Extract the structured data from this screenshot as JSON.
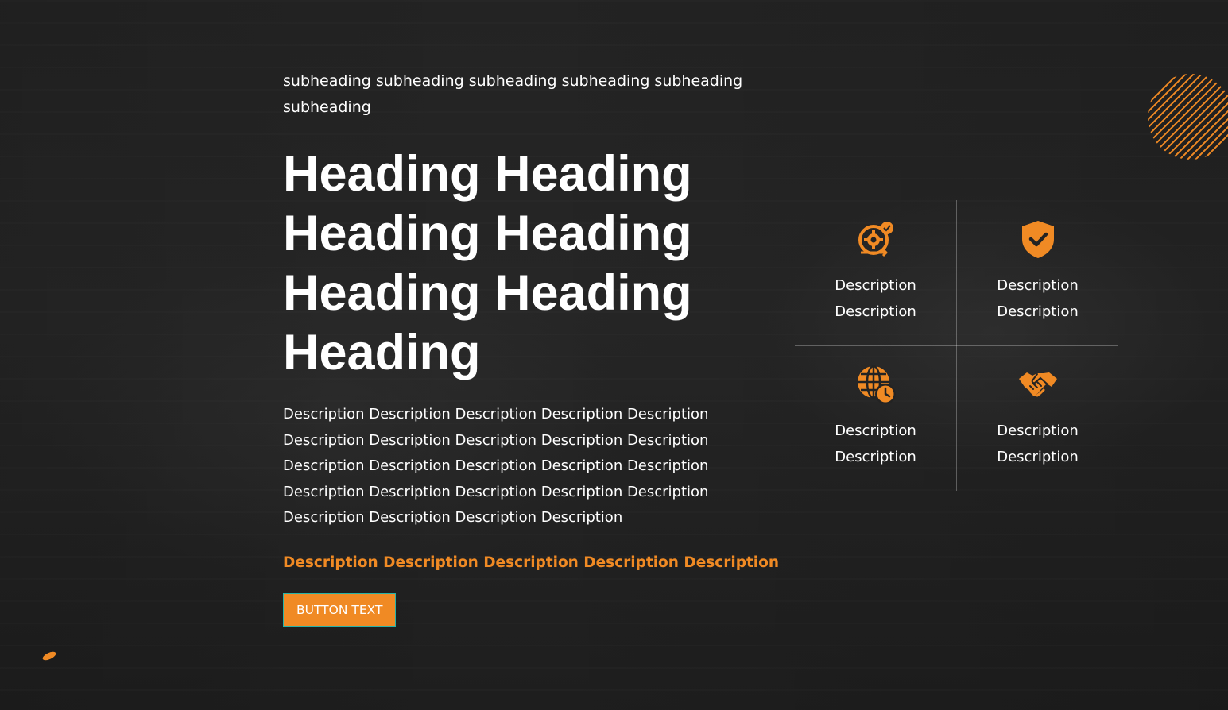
{
  "hero": {
    "subheading": "subheading subheading subheading subheading subheading subheading",
    "heading": "Heading Heading Heading Heading Heading Heading Heading",
    "description": "Description Description Description Description Description Description Description Description Description Description Description Description Description Description Description Description Description Description Description Description Description Description Description Description",
    "highlight": "Description Description Description Description Description",
    "button_label": "BUTTON TEXT"
  },
  "features": [
    {
      "icon": "gear-refresh-check-icon",
      "label": "Description Description"
    },
    {
      "icon": "shield-check-icon",
      "label": "Description Description"
    },
    {
      "icon": "globe-clock-icon",
      "label": "Description Description"
    },
    {
      "icon": "handshake-icon",
      "label": "Description Description"
    }
  ],
  "colors": {
    "accent": "#f08a24",
    "teal": "#27b3a8",
    "background": "#232323",
    "text": "#ffffff"
  }
}
